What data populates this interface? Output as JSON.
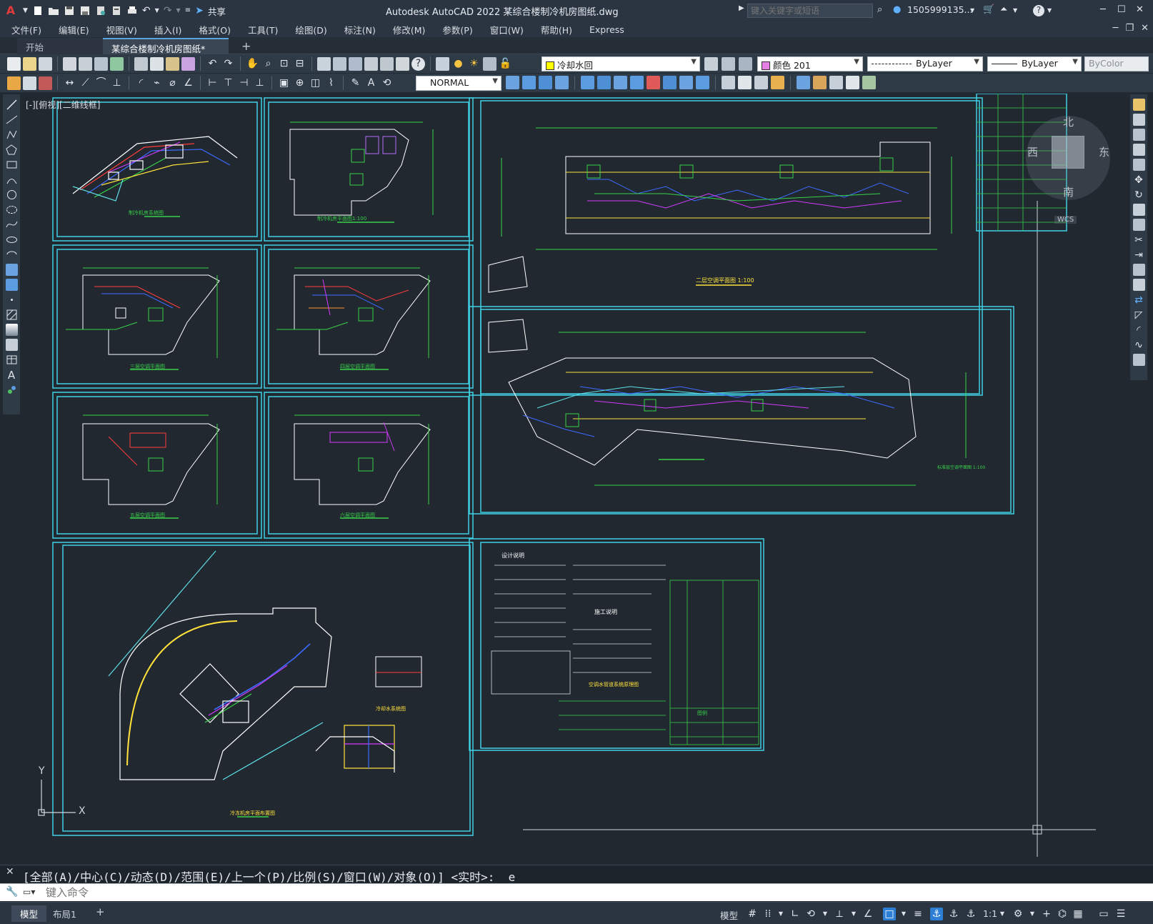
{
  "window": {
    "title": "Autodesk AutoCAD 2022    某综合楼制冷机房图纸.dwg",
    "search_placeholder": "键入关键字或短语",
    "user": "1505999135...",
    "share_label": "共享",
    "minimize": "─",
    "maximize": "☐",
    "close": "✕"
  },
  "menu": {
    "items": [
      "文件(F)",
      "编辑(E)",
      "视图(V)",
      "插入(I)",
      "格式(O)",
      "工具(T)",
      "绘图(D)",
      "标注(N)",
      "修改(M)",
      "参数(P)",
      "窗口(W)",
      "帮助(H)",
      "Express"
    ]
  },
  "tabs": {
    "start": "开始",
    "document": "某综合楼制冷机房图纸*",
    "add": "+"
  },
  "toolbar": {
    "layer": "冷却水回",
    "layer_color": "#ffff00",
    "color": "颜色 201",
    "color_swatch": "#e57fe5",
    "linetype": "ByLayer",
    "lineweight": "ByLayer",
    "plotstyle": "ByColor",
    "textstyle": "NORMAL"
  },
  "canvas": {
    "view_label": "[-][俯视][二维线框]",
    "viewcube": {
      "north": "北",
      "south": "南",
      "east": "东",
      "west": "西",
      "wcs": "WCS"
    },
    "ucs_x": "X",
    "ucs_y": "Y",
    "sheets": {
      "s1": "制冷机房系统图",
      "s2": "制冷机房平面图1:100",
      "s5": "三层空调平面图",
      "s6": "四层空调平面图",
      "s7": "五层空调平面图",
      "s8": "六层空调平面图",
      "top_plan": "二层空调平面图 1:100",
      "mid_plan": "标准层空调平面图 1:100",
      "bottom_plan": "冷冻机房平面布置图",
      "notes_title": "设计说明",
      "notes_sub": "施工说明",
      "legend": "图例",
      "system_title": "冷却水系统图",
      "riser": "空调水管道系统原理图"
    }
  },
  "command": {
    "history": "[全部(A)/中心(C)/动态(D)/范围(E)/上一个(P)/比例(S)/窗口(W)/对象(O)] <实时>: _e",
    "placeholder": "键入命令"
  },
  "status": {
    "model_tab": "模型",
    "layout_tab": "布局1",
    "add_tab": "+",
    "model_btn": "模型",
    "scale": "1:1"
  }
}
